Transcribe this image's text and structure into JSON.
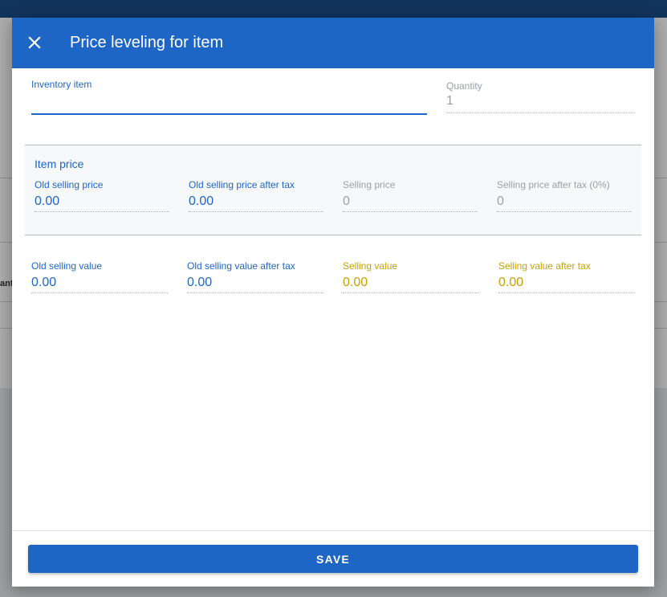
{
  "background": {
    "partial_text": "ant"
  },
  "dialog": {
    "title": "Price leveling for item",
    "close_icon": "close-icon",
    "inventory_item": {
      "label": "Inventory item",
      "value": ""
    },
    "quantity": {
      "label": "Quantity",
      "value": "1"
    },
    "item_price": {
      "title": "Item price",
      "fields": [
        {
          "label": "Old selling price",
          "value": "0.00"
        },
        {
          "label": "Old selling price after tax",
          "value": "0.00"
        },
        {
          "label": "Selling price",
          "value": "0"
        },
        {
          "label": "Selling price after tax (0%)",
          "value": "0"
        }
      ]
    },
    "values": [
      {
        "label": "Old selling value",
        "value": "0.00"
      },
      {
        "label": "Old selling value after tax",
        "value": "0.00"
      },
      {
        "label": "Selling value",
        "value": "0.00"
      },
      {
        "label": "Selling value after tax",
        "value": "0.00"
      }
    ],
    "save_label": "SAVE"
  },
  "colors": {
    "primary": "#1e66c5",
    "accent_gold": "#c9a000",
    "disabled": "#9aa0a6"
  }
}
